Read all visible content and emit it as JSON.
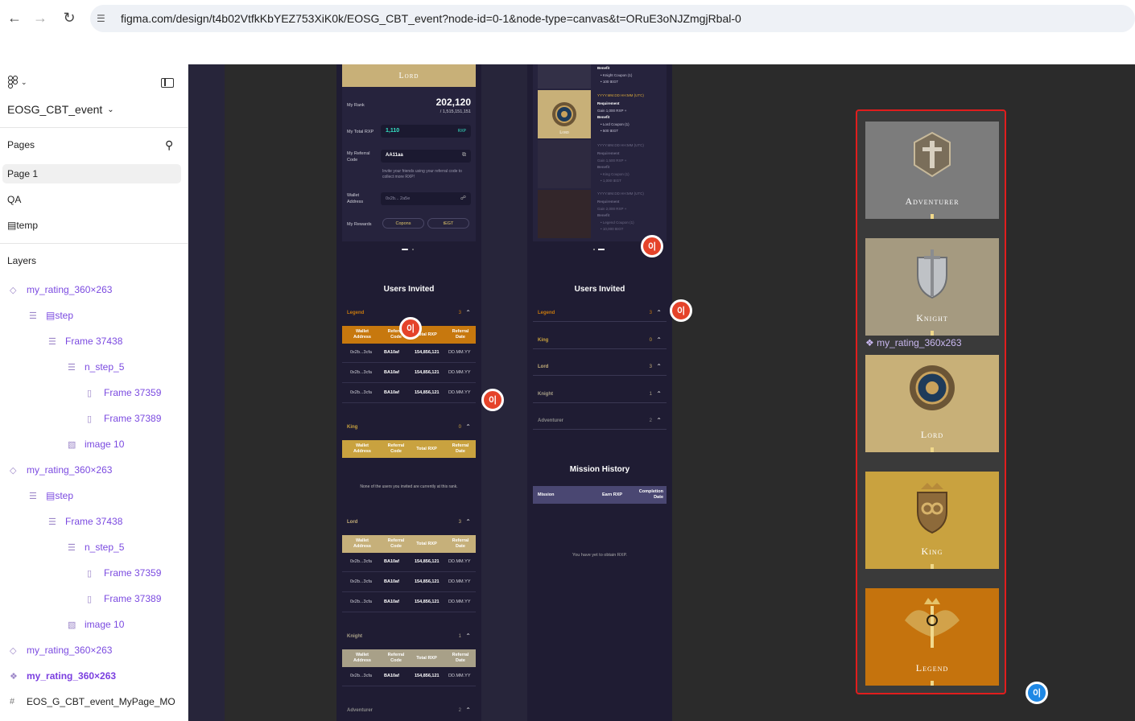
{
  "browser": {
    "url": "figma.com/design/t4b02VtfkKbYEZ753XiK0k/EOSG_CBT_event?node-id=0-1&node-type=canvas&t=ORuE3oNJZmgjRbal-0"
  },
  "sidebar": {
    "file_name": "EOSG_CBT_event",
    "pages_label": "Pages",
    "pages": [
      "Page 1",
      "QA",
      "▤temp"
    ],
    "layers_label": "Layers",
    "layers": [
      {
        "label": "my_rating_360×263",
        "icon": "component-outline-icon"
      },
      {
        "label": "▤step",
        "icon": "frame-lines-icon"
      },
      {
        "label": "Frame 37438",
        "icon": "frame-lines-icon"
      },
      {
        "label": "n_step_5",
        "icon": "frame-lines-icon"
      },
      {
        "label": "Frame 37359",
        "icon": "frame-columns-icon"
      },
      {
        "label": "Frame 37389",
        "icon": "frame-columns-icon"
      },
      {
        "label": "image 10",
        "icon": "image-icon"
      },
      {
        "label": "my_rating_360×263",
        "icon": "component-outline-icon"
      },
      {
        "label": "▤step",
        "icon": "frame-lines-icon"
      },
      {
        "label": "Frame 37438",
        "icon": "frame-lines-icon"
      },
      {
        "label": "n_step_5",
        "icon": "frame-lines-icon"
      },
      {
        "label": "Frame 37359",
        "icon": "frame-columns-icon"
      },
      {
        "label": "Frame 37389",
        "icon": "frame-columns-icon"
      },
      {
        "label": "image 10",
        "icon": "image-icon"
      },
      {
        "label": "my_rating_360×263",
        "icon": "component-outline-icon"
      },
      {
        "label": "my_rating_360×263",
        "icon": "component-set-icon"
      },
      {
        "label": "EOS_G_CBT_event_MyPage_MO",
        "icon": "hash-frame-icon"
      }
    ]
  },
  "left_mobile": {
    "top_label": "Lord",
    "my_rank_label": "My Rank",
    "my_rank_value": "202,120",
    "my_rank_total": "/ 1,515,151,151",
    "total_rxp_label": "My Total RXP",
    "total_rxp_value": "1,110",
    "rxp_unit": "RXP",
    "referral_label": "My Referral Code",
    "referral_value": "AA11aa",
    "referral_hint": "Invite your friends using your referral code to collect more RXP!",
    "wallet_label": "Wallet Address",
    "wallet_value": "0x2b... 2a5e",
    "rewards_label": "My Rewards",
    "rewards_buttons": [
      "Copons",
      "tEGT"
    ],
    "users_invited_title": "Users Invited",
    "col_headers": [
      "Wallet Address",
      "Referral Code",
      "Total RXP",
      "Referral Date"
    ],
    "sections": [
      {
        "name": "Legend",
        "count": "3",
        "rows": [
          [
            "0x2b...3cfa",
            "BA10af",
            "154,856,121",
            "DD.MM.YY"
          ],
          [
            "0x2b...3cfa",
            "BA10af",
            "154,856,121",
            "DD.MM.YY"
          ],
          [
            "0x2b...3cfa",
            "BA10af",
            "154,856,121",
            "DD.MM.YY"
          ]
        ]
      },
      {
        "name": "King",
        "count": "0",
        "empty": "None of the users you invited are currently at this rank."
      },
      {
        "name": "Lord",
        "count": "3",
        "rows": [
          [
            "0x2b...3cfa",
            "BA10af",
            "154,856,121",
            "DD.MM.YY"
          ],
          [
            "0x2b...3cfa",
            "BA10af",
            "154,856,121",
            "DD.MM.YY"
          ],
          [
            "0x2b...3cfa",
            "BA10af",
            "154,856,121",
            "DD.MM.YY"
          ]
        ]
      },
      {
        "name": "Knight",
        "count": "1",
        "rows": [
          [
            "0x2b...3cfa",
            "BA10af",
            "154,856,121",
            "DD.MM.YY"
          ]
        ]
      },
      {
        "name": "Adventurer",
        "count": "2"
      }
    ]
  },
  "right_mobile": {
    "benefit_label": "Benefit",
    "items": [
      {
        "date": "",
        "lines": [
          "Benefit",
          "• Knight Coupon (1)",
          "• 100 tEGT"
        ]
      },
      {
        "date": "YYYY.MM.DD HH:MM (UTC)",
        "lines": [
          "Requirement",
          "Gain 1,000 RXP +",
          "Benefit",
          "• Lord Coupon (1)",
          "• 500 tEGT"
        ]
      },
      {
        "date": "YYYY.MM.DD HH:MM (UTC)",
        "lines": [
          "Requirement",
          "Gain 1,500 RXP +",
          "Benefit",
          "• King Coupon (1)",
          "• 1,000 tEGT"
        ]
      },
      {
        "date": "YYYY.MM.DD HH:MM (UTC)",
        "lines": [
          "Requirement",
          "Gain 2,000 RXP +",
          "Benefit",
          "• Legend Coupon (1)",
          "• 10,000 tEGT"
        ]
      }
    ],
    "thumb_label": "Lord",
    "users_invited_title": "Users Invited",
    "ranks": [
      {
        "name": "Legend",
        "count": "3"
      },
      {
        "name": "King",
        "count": "0"
      },
      {
        "name": "Lord",
        "count": "3"
      },
      {
        "name": "Knight",
        "count": "1"
      },
      {
        "name": "Adventurer",
        "count": "2"
      }
    ],
    "mission_title": "Mission History",
    "mission_headers": [
      "Mission",
      "Earn RXP",
      "Completion Date"
    ],
    "mission_empty": "You have yet to obtain RXP."
  },
  "rating_component": {
    "label": "my_rating_360x263",
    "cards": [
      {
        "name": "Adventurer",
        "color": "#7c7c7c"
      },
      {
        "name": "Knight",
        "color": "#a59a80"
      },
      {
        "name": "Lord",
        "color": "#c8b078"
      },
      {
        "name": "King",
        "color": "#c9a23f"
      },
      {
        "name": "Legend",
        "color": "#c5730d"
      }
    ]
  },
  "comment_badge": "이",
  "colors": {
    "legend": "#c7780e",
    "king": "#c9a23f",
    "lord": "#c6b07a",
    "knight": "#a8a088",
    "selection": "#e11d1d"
  }
}
